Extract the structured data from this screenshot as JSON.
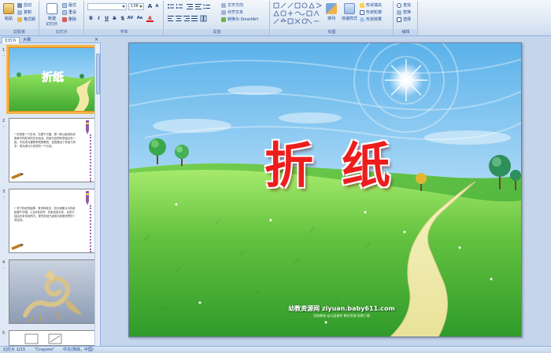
{
  "ribbon": {
    "clipboard": {
      "label": "剪贴板",
      "paste": "粘贴",
      "cut": "剪切",
      "copy": "复制",
      "format_painter": "格式刷"
    },
    "slides": {
      "label": "幻灯片",
      "new_slide_line1": "新建",
      "new_slide_line2": "幻灯片",
      "layout": "版式",
      "reset": "重设",
      "delete": "删除"
    },
    "font": {
      "label": "字体",
      "font_name": "",
      "font_size": "138",
      "bold": "B",
      "italic": "I",
      "underline": "U",
      "strike": "S",
      "shadow": "S",
      "spacing": "AV",
      "case": "Aa",
      "color": "A"
    },
    "paragraph": {
      "label": "段落",
      "text_direction": "文字方向",
      "align_text": "对齐文本",
      "smartart": "转换为 SmartArt"
    },
    "drawing": {
      "label": "绘图",
      "arrange": "排列",
      "quick_styles": "快速样式",
      "shape_fill": "形状填充",
      "shape_outline": "形状轮廓",
      "shape_effects": "形状效果"
    },
    "editing": {
      "label": "编辑",
      "find": "查找",
      "replace": "替换",
      "select": "选择"
    }
  },
  "left_pane": {
    "tabs": [
      "幻灯片",
      "大纲"
    ],
    "close": "×",
    "thumbs": [
      {
        "num": "1",
        "title": "折纸",
        "selected": true
      },
      {
        "num": "2",
        "text": "• 折纸是一门艺术，它源于中国，是一种以纸张折成各种不同形状的艺术活动。折纸与自然科学结合在一起，不仅成为建筑学院的教具，还发展出了折纸几何学，成为现代几何学的一个分支。"
      },
      {
        "num": "3",
        "text": "• 关于折纸的起源，有多种说法，但大家都认为折纸起源于中国。公元6世纪时，折纸传到日本，后来又经由日本传到西方。现在折纸已经成为风靡世界的一项活动。"
      },
      {
        "num": "4",
        "text": ""
      },
      {
        "num": "5",
        "text": ""
      }
    ]
  },
  "slide": {
    "title": "折纸",
    "watermark": "幼教资源网 ziyuan.baby611.com",
    "watermark_sub": "学前教育  幼儿园课件  教学资源  免费下载"
  },
  "statusbar": {
    "slide_info": "幻灯片 1/23",
    "theme": "\"Crayons\"",
    "language": "中文(简体，中国)"
  },
  "colors": {
    "ribbon_bg": "#dbe6f4",
    "title_red": "#ee1d1d",
    "grass": "#5fc040",
    "sky": "#8ecbf0",
    "selection": "#f5b44a"
  }
}
